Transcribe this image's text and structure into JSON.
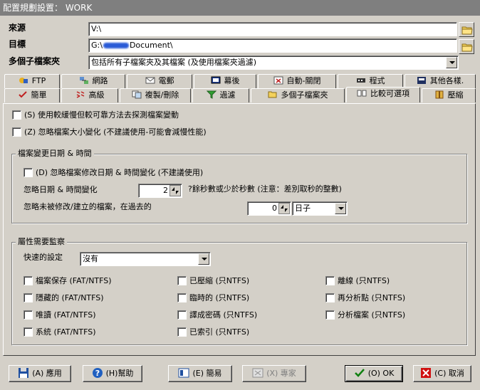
{
  "window": {
    "title": "配置規劃設置： WORK"
  },
  "fields": {
    "source_label": "來源",
    "source_value": "V:\\",
    "target_label": "目標",
    "target_prefix": "G:\\",
    "target_suffix": "Document\\",
    "subfolders_label": "多個子檔案夾",
    "subfolders_value": "包括所有子檔案夾及其檔案 (及使用檔案夾過濾)"
  },
  "tabs_row1": [
    "FTP",
    "網路",
    "電郵",
    "幕後",
    "自動-關閉",
    "程式",
    "其他各樣."
  ],
  "tabs_row2": [
    "簡單",
    "高級",
    "複製/刪除",
    "過濾",
    "多個子檔案夾",
    "比較可選項",
    "壓縮"
  ],
  "options": {
    "slow_method": "(S) 使用較緩慢但較可靠方法去探測檔案變動",
    "ignore_size": "(Z) 忽略檔案大小變化 (不建議使用-可能會減慢性能)"
  },
  "datetime_group": {
    "title": "檔案變更日期 & 時間",
    "ignore_mod": "(D) 忽略檔案修改日期 & 時間變化 (不建議使用)",
    "ignore_diff_label": "忽略日期 & 時間變化",
    "ignore_diff_value": "2",
    "ignore_diff_suffix": "?餘秒數或少於秒數 (注意：差別取秒的整數)",
    "ignore_old_label": "忽略未被修改/建立的檔案，在過去的",
    "ignore_old_value": "0",
    "ignore_old_unit": "日子"
  },
  "attr_group": {
    "title": "屬性需要監察",
    "quick_label": "快速的設定",
    "quick_value": "沒有",
    "col1": [
      "檔案保存 (FAT/NTFS)",
      "隱藏的 (FAT/NTFS)",
      "唯讀 (FAT/NTFS)",
      "系統 (FAT/NTFS)"
    ],
    "col2": [
      "已壓縮 (只NTFS)",
      "臨時的 (只NTFS)",
      "譯成密碼 (只NTFS)",
      "已索引 (只NTFS)"
    ],
    "col3": [
      "離線 (只NTFS)",
      "再分析點 (只NTFS)",
      "分析檔案 (只NTFS)"
    ]
  },
  "buttons": {
    "apply": "(A) 應用",
    "help": "(H)幫助",
    "simple": "(E) 簡易",
    "expert": "(X) 專家",
    "ok": "(O) OK",
    "cancel": "(C) 取消"
  }
}
